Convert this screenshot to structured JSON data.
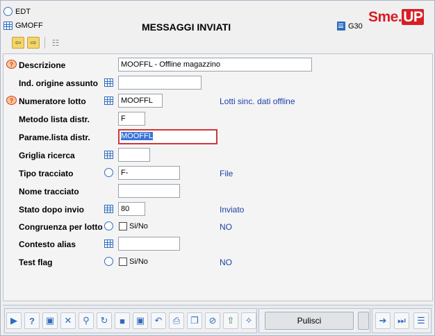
{
  "header": {
    "edt_label": "EDT",
    "gmoff_label": "GMOFF",
    "title": "MESSAGGI INVIATI",
    "g30_label": "G30",
    "logo_main": "Sme",
    "logo_dot": ".",
    "logo_up": "UP"
  },
  "toolbar": {
    "prev_icon": "⇦",
    "next_icon": "⇨",
    "tree_icon": "☷"
  },
  "form": {
    "descrizione": {
      "label": "Descrizione",
      "value": "MOOFFL - Offline magazzino"
    },
    "ind_origine": {
      "label": "Ind. origine assunto",
      "value": ""
    },
    "numeratore": {
      "label": "Numeratore lotto",
      "value": "MOOFFL",
      "note": "Lotti sinc. dati offline"
    },
    "metodo": {
      "label": "Metodo lista distr.",
      "value": "F"
    },
    "parame": {
      "label": "Parame.lista distr.",
      "value": "MOOFFL"
    },
    "griglia": {
      "label": "Griglia ricerca",
      "value": ""
    },
    "tipo_tracciato": {
      "label": "Tipo tracciato",
      "value": "F-",
      "note": "File"
    },
    "nome_tracciato": {
      "label": "Nome tracciato",
      "value": ""
    },
    "stato": {
      "label": "Stato dopo invio",
      "value": "80",
      "note": "Inviato"
    },
    "congruenza": {
      "label": "Congruenza per lotto",
      "check_label": "Si/No",
      "note": "NO"
    },
    "contesto": {
      "label": "Contesto alias",
      "value": ""
    },
    "test_flag": {
      "label": "Test flag",
      "check_label": "Si/No",
      "note": "NO"
    }
  },
  "bottom": {
    "pulisci_label": "Pulisci",
    "icons": [
      "play-icon",
      "help-icon",
      "terminal-icon",
      "close-icon",
      "search-icon",
      "refresh-icon",
      "save-icon",
      "save-all-icon",
      "undo-icon",
      "print-icon",
      "copy-icon",
      "cancel-icon",
      "upload-icon",
      "wand-icon"
    ],
    "glyphs": {
      "play": "▶",
      "help": "?",
      "terminal": "▣",
      "close": "✕",
      "search": "⚲",
      "refresh": "↻",
      "save": "■",
      "save_all": "▣",
      "undo": "↶",
      "print": "⎙",
      "copy": "❐",
      "cancel": "⊘",
      "upload": "⇧",
      "wand": "✧",
      "arrow_right": "➔",
      "skip_end": "⏭",
      "list": "☰"
    }
  },
  "colors": {
    "accent": "#2e6cc0",
    "logo_red": "#d81e25",
    "note_blue": "#1c3fa5",
    "focus_border": "#d0353a"
  }
}
